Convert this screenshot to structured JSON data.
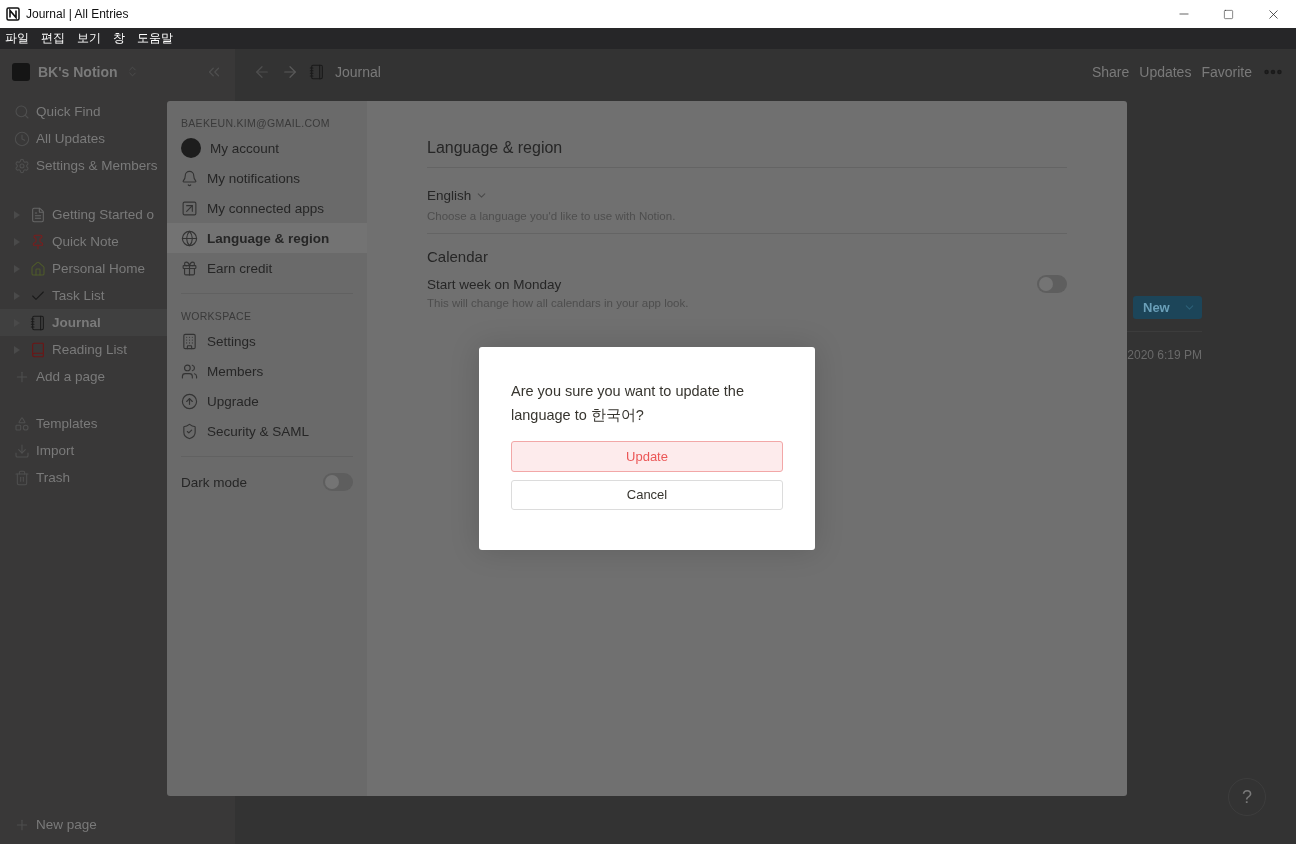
{
  "window": {
    "title": "Journal | All Entries"
  },
  "menu_bar": [
    "파일",
    "편집",
    "보기",
    "창",
    "도움말"
  ],
  "sidebar": {
    "workspace": "BK's Notion",
    "nav": [
      "Quick Find",
      "All Updates",
      "Settings & Members"
    ],
    "pages": [
      {
        "label": "Getting Started o",
        "selected": false
      },
      {
        "label": "Quick Note",
        "selected": false
      },
      {
        "label": "Personal Home",
        "selected": false
      },
      {
        "label": "Task List",
        "selected": false
      },
      {
        "label": "Journal",
        "selected": true
      },
      {
        "label": "Reading List",
        "selected": false
      }
    ],
    "add_page": "Add a page",
    "tools": [
      "Templates",
      "Import",
      "Trash"
    ],
    "new_page": "New page"
  },
  "topbar": {
    "breadcrumb": "Journal",
    "actions": [
      "Share",
      "Updates",
      "Favorite"
    ]
  },
  "content": {
    "new_button": "New",
    "date_cell": "2020 6:19 PM",
    "help": "?"
  },
  "settings": {
    "email": "BAEKEUN.KIM@GMAIL.COM",
    "account_items": [
      {
        "label": "My account",
        "selected": false
      },
      {
        "label": "My notifications",
        "selected": false
      },
      {
        "label": "My connected apps",
        "selected": false
      },
      {
        "label": "Language & region",
        "selected": true
      },
      {
        "label": "Earn credit",
        "selected": false
      }
    ],
    "workspace_heading": "WORKSPACE",
    "workspace_items": [
      {
        "label": "Settings",
        "selected": false
      },
      {
        "label": "Members",
        "selected": false
      },
      {
        "label": "Upgrade",
        "selected": false
      },
      {
        "label": "Security & SAML",
        "selected": false
      }
    ],
    "dark_mode": {
      "label": "Dark mode",
      "on": false
    },
    "title": "Language & region",
    "language": {
      "value": "English",
      "hint": "Choose a language you'd like to use with Notion."
    },
    "calendar": {
      "title": "Calendar",
      "label": "Start week on Monday",
      "hint": "This will change how all calendars in your app look.",
      "on": false
    }
  },
  "dialog": {
    "message": "Are you sure you want to update the language to 한국어?",
    "buttons": [
      {
        "label": "Update",
        "kind": "danger"
      },
      {
        "label": "Cancel",
        "kind": "default"
      }
    ]
  }
}
